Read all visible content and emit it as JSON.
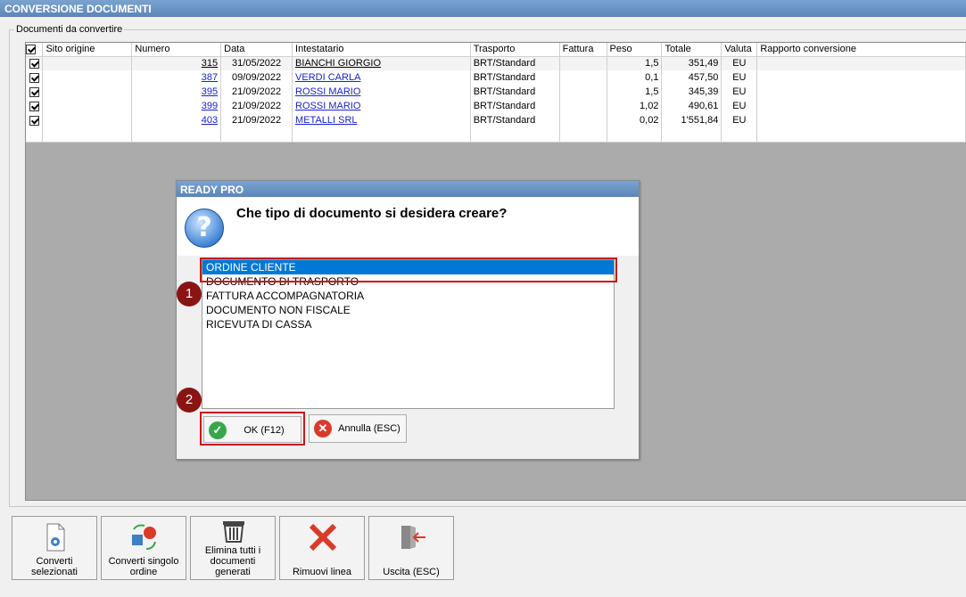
{
  "window": {
    "title": "CONVERSIONE DOCUMENTI"
  },
  "group": {
    "label": "Documenti da convertire"
  },
  "grid": {
    "headers": [
      "Sito origine",
      "Numero",
      "Data",
      "Intestatario",
      "Trasporto",
      "Fattura",
      "Peso",
      "Totale",
      "Valuta",
      "Rapporto conversione"
    ],
    "rows": [
      {
        "checked": true,
        "sito": "",
        "numero": "315",
        "data": "31/05/2022",
        "intestatario": "BIANCHI GIORGIO",
        "trasporto": "BRT/Standard",
        "fattura": "",
        "peso": "1,5",
        "totale": "351,49",
        "valuta": "EU",
        "rapporto": ""
      },
      {
        "checked": true,
        "sito": "",
        "numero": "387",
        "data": "09/09/2022",
        "intestatario": "VERDI CARLA",
        "trasporto": "BRT/Standard",
        "fattura": "",
        "peso": "0,1",
        "totale": "457,50",
        "valuta": "EU",
        "rapporto": ""
      },
      {
        "checked": true,
        "sito": "",
        "numero": "395",
        "data": "21/09/2022",
        "intestatario": "ROSSI MARIO",
        "trasporto": "BRT/Standard",
        "fattura": "",
        "peso": "1,5",
        "totale": "345,39",
        "valuta": "EU",
        "rapporto": ""
      },
      {
        "checked": true,
        "sito": "",
        "numero": "399",
        "data": "21/09/2022",
        "intestatario": "ROSSI MARIO",
        "trasporto": "BRT/Standard",
        "fattura": "",
        "peso": "1,02",
        "totale": "490,61",
        "valuta": "EU",
        "rapporto": ""
      },
      {
        "checked": true,
        "sito": "",
        "numero": "403",
        "data": "21/09/2022",
        "intestatario": "METALLI SRL",
        "trasporto": "BRT/Standard",
        "fattura": "",
        "peso": "0,02",
        "totale": "1'551,84",
        "valuta": "EU",
        "rapporto": ""
      }
    ]
  },
  "dialog": {
    "title": "READY PRO",
    "question": "Che tipo di documento si desidera creare?",
    "options": [
      "ORDINE CLIENTE",
      "DOCUMENTO DI TRASPORTO",
      "FATTURA ACCOMPAGNATORIA",
      "DOCUMENTO NON FISCALE",
      "RICEVUTA DI CASSA"
    ],
    "selected_option": "ORDINE CLIENTE",
    "ok_label": "OK (F12)",
    "cancel_label": "Annulla (ESC)"
  },
  "badges": {
    "one": "1",
    "two": "2"
  },
  "toolbar": {
    "converti_selezionati": "Converti selezionati",
    "converti_singolo": "Converti singolo ordine",
    "elimina_tutti": "Elimina tutti i documenti generati",
    "rimuovi_linea": "Rimuovi linea",
    "uscita": "Uscita (ESC)"
  },
  "colors": {
    "highlight": "#c41a1a",
    "badge": "#8a1414",
    "selection": "#0078d7",
    "link": "#1a23c9"
  }
}
